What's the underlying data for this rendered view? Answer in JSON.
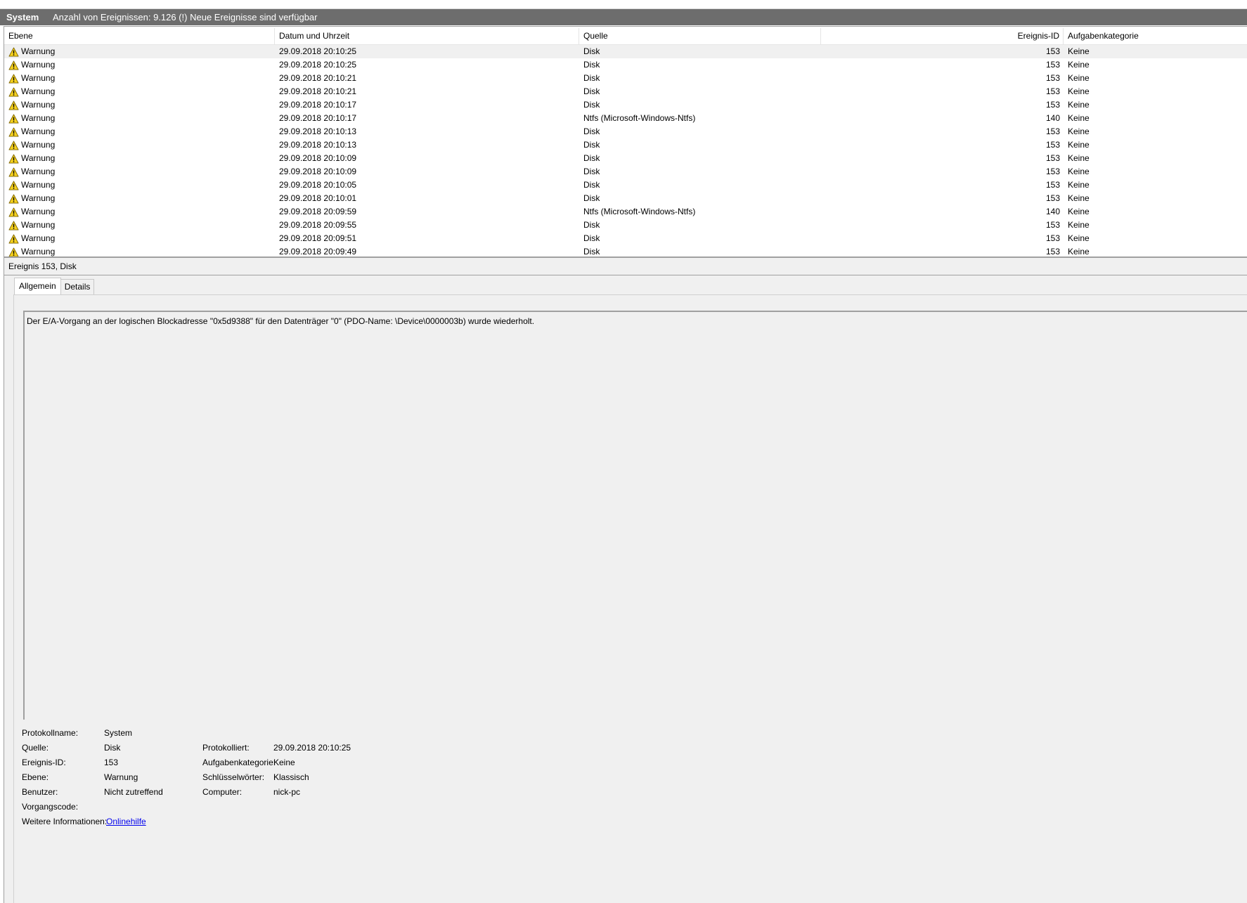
{
  "header": {
    "log_name": "System",
    "info": "Anzahl von Ereignissen: 9.126 (!) Neue Ereignisse sind verfügbar"
  },
  "columns": {
    "ebene": "Ebene",
    "datum": "Datum und Uhrzeit",
    "quelle": "Quelle",
    "id": "Ereignis-ID",
    "kategorie": "Aufgabenkategorie"
  },
  "events": [
    {
      "level": "Warnung",
      "datetime": "29.09.2018 20:10:25",
      "source": "Disk",
      "id": "153",
      "category": "Keine"
    },
    {
      "level": "Warnung",
      "datetime": "29.09.2018 20:10:25",
      "source": "Disk",
      "id": "153",
      "category": "Keine"
    },
    {
      "level": "Warnung",
      "datetime": "29.09.2018 20:10:21",
      "source": "Disk",
      "id": "153",
      "category": "Keine"
    },
    {
      "level": "Warnung",
      "datetime": "29.09.2018 20:10:21",
      "source": "Disk",
      "id": "153",
      "category": "Keine"
    },
    {
      "level": "Warnung",
      "datetime": "29.09.2018 20:10:17",
      "source": "Disk",
      "id": "153",
      "category": "Keine"
    },
    {
      "level": "Warnung",
      "datetime": "29.09.2018 20:10:17",
      "source": "Ntfs (Microsoft-Windows-Ntfs)",
      "id": "140",
      "category": "Keine"
    },
    {
      "level": "Warnung",
      "datetime": "29.09.2018 20:10:13",
      "source": "Disk",
      "id": "153",
      "category": "Keine"
    },
    {
      "level": "Warnung",
      "datetime": "29.09.2018 20:10:13",
      "source": "Disk",
      "id": "153",
      "category": "Keine"
    },
    {
      "level": "Warnung",
      "datetime": "29.09.2018 20:10:09",
      "source": "Disk",
      "id": "153",
      "category": "Keine"
    },
    {
      "level": "Warnung",
      "datetime": "29.09.2018 20:10:09",
      "source": "Disk",
      "id": "153",
      "category": "Keine"
    },
    {
      "level": "Warnung",
      "datetime": "29.09.2018 20:10:05",
      "source": "Disk",
      "id": "153",
      "category": "Keine"
    },
    {
      "level": "Warnung",
      "datetime": "29.09.2018 20:10:01",
      "source": "Disk",
      "id": "153",
      "category": "Keine"
    },
    {
      "level": "Warnung",
      "datetime": "29.09.2018 20:09:59",
      "source": "Ntfs (Microsoft-Windows-Ntfs)",
      "id": "140",
      "category": "Keine"
    },
    {
      "level": "Warnung",
      "datetime": "29.09.2018 20:09:55",
      "source": "Disk",
      "id": "153",
      "category": "Keine"
    },
    {
      "level": "Warnung",
      "datetime": "29.09.2018 20:09:51",
      "source": "Disk",
      "id": "153",
      "category": "Keine"
    },
    {
      "level": "Warnung",
      "datetime": "29.09.2018 20:09:49",
      "source": "Disk",
      "id": "153",
      "category": "Keine"
    }
  ],
  "detail": {
    "title": "Ereignis 153, Disk",
    "tabs": [
      "Allgemein",
      "Details"
    ],
    "description": "Der E/A-Vorgang an der logischen Blockadresse \"0x5d9388\" für den Datenträger \"0\" (PDO-Name: \\Device\\0000003b) wurde wiederholt.",
    "props": {
      "protokollname_label": "Protokollname:",
      "protokollname_value": "System",
      "quelle_label": "Quelle:",
      "quelle_value": "Disk",
      "protokolliert_label": "Protokolliert:",
      "protokolliert_value": "29.09.2018 20:10:25",
      "ereignisid_label": "Ereignis-ID:",
      "ereignisid_value": "153",
      "aufgabenkategorie_label": "Aufgabenkategorie:",
      "aufgabenkategorie_value": "Keine",
      "ebene_label": "Ebene:",
      "ebene_value": "Warnung",
      "schluesselwoerter_label": "Schlüsselwörter:",
      "schluesselwoerter_value": "Klassisch",
      "benutzer_label": "Benutzer:",
      "benutzer_value": "Nicht zutreffend",
      "computer_label": "Computer:",
      "computer_value": "nick-pc",
      "vorgangscode_label": "Vorgangscode:",
      "weitere_label": "Weitere Informationen:",
      "weitere_link": "Onlinehilfe"
    }
  },
  "icons": {
    "warning": "warning-icon"
  },
  "colors": {
    "header_bg": "#6d6d6d",
    "warning_yellow": "#f7d21e",
    "link": "#0000ee"
  }
}
